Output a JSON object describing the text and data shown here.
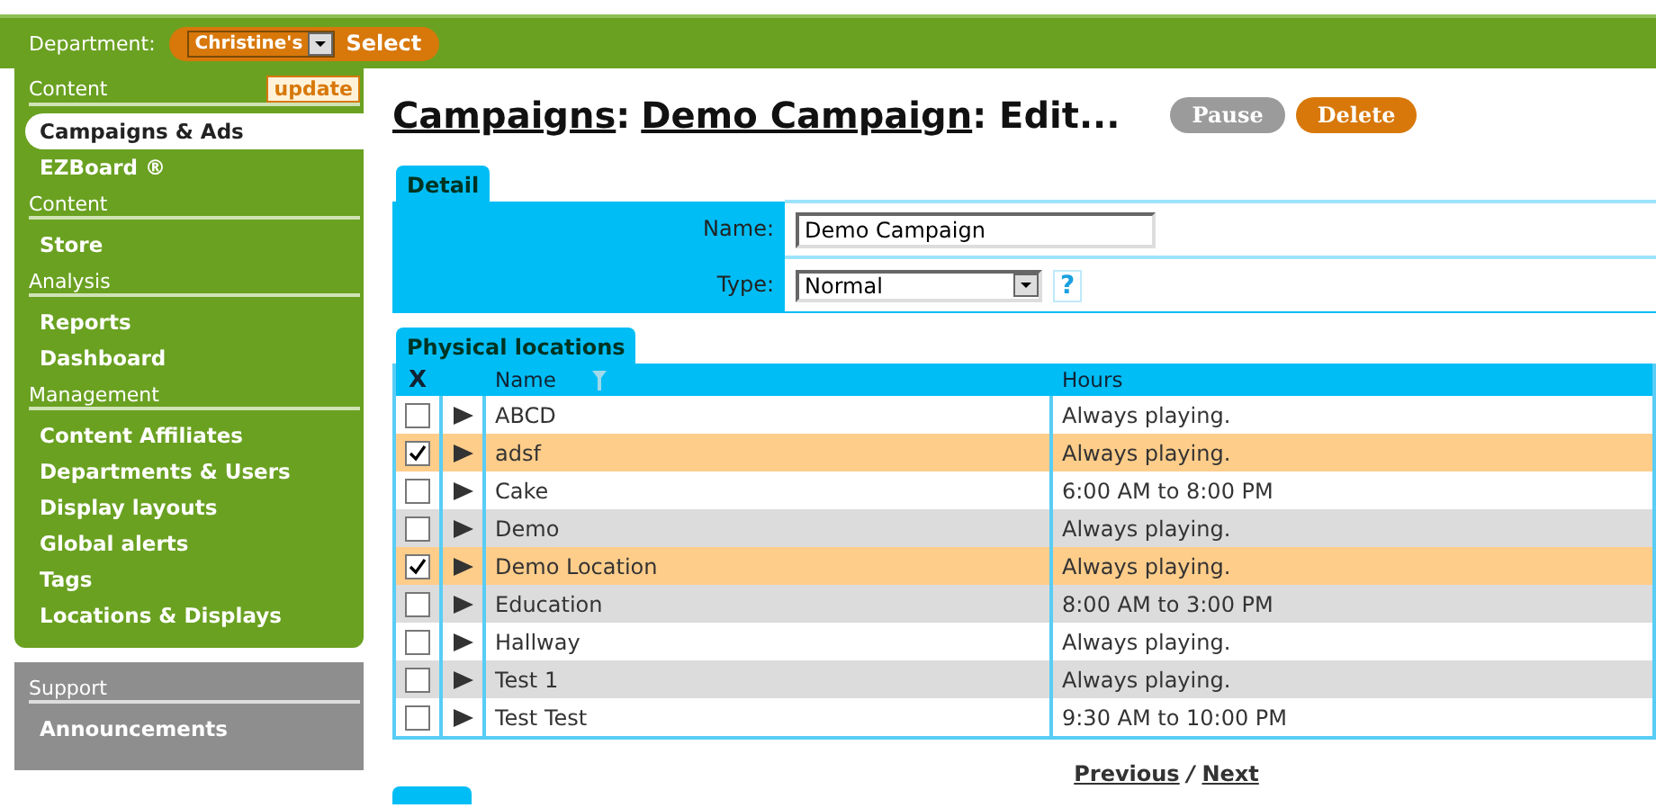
{
  "topbar": {
    "department_label": "Department:",
    "department_value": "Christine's",
    "select_button": "Select"
  },
  "sidebar": {
    "sections": [
      {
        "heading": "Content",
        "badge": "update",
        "items": [
          {
            "label": "Campaigns & Ads",
            "selected": true
          },
          {
            "label": "EZBoard ®",
            "selected": false
          }
        ]
      },
      {
        "heading": "Content",
        "items": [
          {
            "label": "Store",
            "selected": false
          }
        ]
      },
      {
        "heading": "Analysis",
        "items": [
          {
            "label": "Reports",
            "selected": false
          },
          {
            "label": "Dashboard",
            "selected": false
          }
        ]
      },
      {
        "heading": "Management",
        "items": [
          {
            "label": "Content Affiliates",
            "selected": false
          },
          {
            "label": "Departments & Users",
            "selected": false
          },
          {
            "label": "Display layouts",
            "selected": false
          },
          {
            "label": "Global alerts",
            "selected": false
          },
          {
            "label": "Tags",
            "selected": false
          },
          {
            "label": "Locations & Displays",
            "selected": false
          }
        ]
      }
    ],
    "support": {
      "heading": "Support",
      "items": [
        {
          "label": "Announcements",
          "selected": false
        }
      ]
    }
  },
  "title": {
    "crumbs": [
      "Campaigns",
      "Demo Campaign"
    ],
    "separator": ":",
    "last": ": Edit...",
    "buttons": [
      {
        "label": "Pause",
        "kind": "grey"
      },
      {
        "label": "Delete",
        "kind": "orange"
      }
    ]
  },
  "detail": {
    "tab": "Detail",
    "fields": [
      {
        "label": "Name:",
        "kind": "text",
        "value": "Demo Campaign"
      },
      {
        "label": "Type:",
        "kind": "select",
        "value": "Normal",
        "help": "?"
      }
    ]
  },
  "locations": {
    "tab": "Physical locations",
    "columns": [
      "X",
      "Name",
      "Hours"
    ],
    "rows": [
      {
        "name": "ABCD",
        "hours": "Always playing.",
        "checked": false
      },
      {
        "name": "adsf",
        "hours": "Always playing.",
        "checked": true
      },
      {
        "name": "Cake",
        "hours": "6:00 AM to 8:00 PM",
        "checked": false
      },
      {
        "name": "Demo",
        "hours": "Always playing.",
        "checked": false
      },
      {
        "name": "Demo Location",
        "hours": "Always playing.",
        "checked": true
      },
      {
        "name": "Education",
        "hours": "8:00 AM to 3:00 PM",
        "checked": false
      },
      {
        "name": "Hallway",
        "hours": "Always playing.",
        "checked": false
      },
      {
        "name": "Test 1",
        "hours": "Always playing.",
        "checked": false
      },
      {
        "name": "Test Test",
        "hours": "9:30 AM to 10:00 PM",
        "checked": false
      }
    ],
    "pager": {
      "previous": "Previous",
      "separator": "/",
      "next": "Next"
    }
  }
}
